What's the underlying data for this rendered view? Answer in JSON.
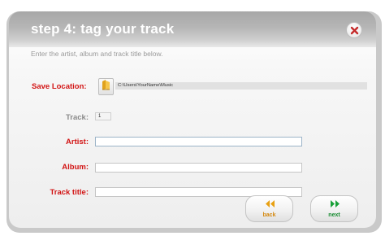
{
  "dialog": {
    "title": "step 4: tag your track",
    "subtitle": "Enter the artist, album and track title below."
  },
  "form": {
    "save_location": {
      "label": "Save Location:",
      "path": "C:\\Users\\YourName\\Music"
    },
    "track": {
      "label": "Track:",
      "value": "1"
    },
    "artist": {
      "label": "Artist:",
      "value": ""
    },
    "album": {
      "label": "Album:",
      "value": ""
    },
    "track_title": {
      "label": "Track title:",
      "value": ""
    }
  },
  "buttons": {
    "back": "back",
    "next": "next"
  },
  "icons": {
    "close": "close-icon",
    "folder": "folder-icon",
    "back": "rewind-icon",
    "next": "fast-forward-icon"
  },
  "colors": {
    "required_label": "#d21414",
    "secondary_label": "#8a8a8a",
    "back_accent": "#d4880e",
    "next_accent": "#148a2e",
    "close_accent": "#c42a2a"
  }
}
